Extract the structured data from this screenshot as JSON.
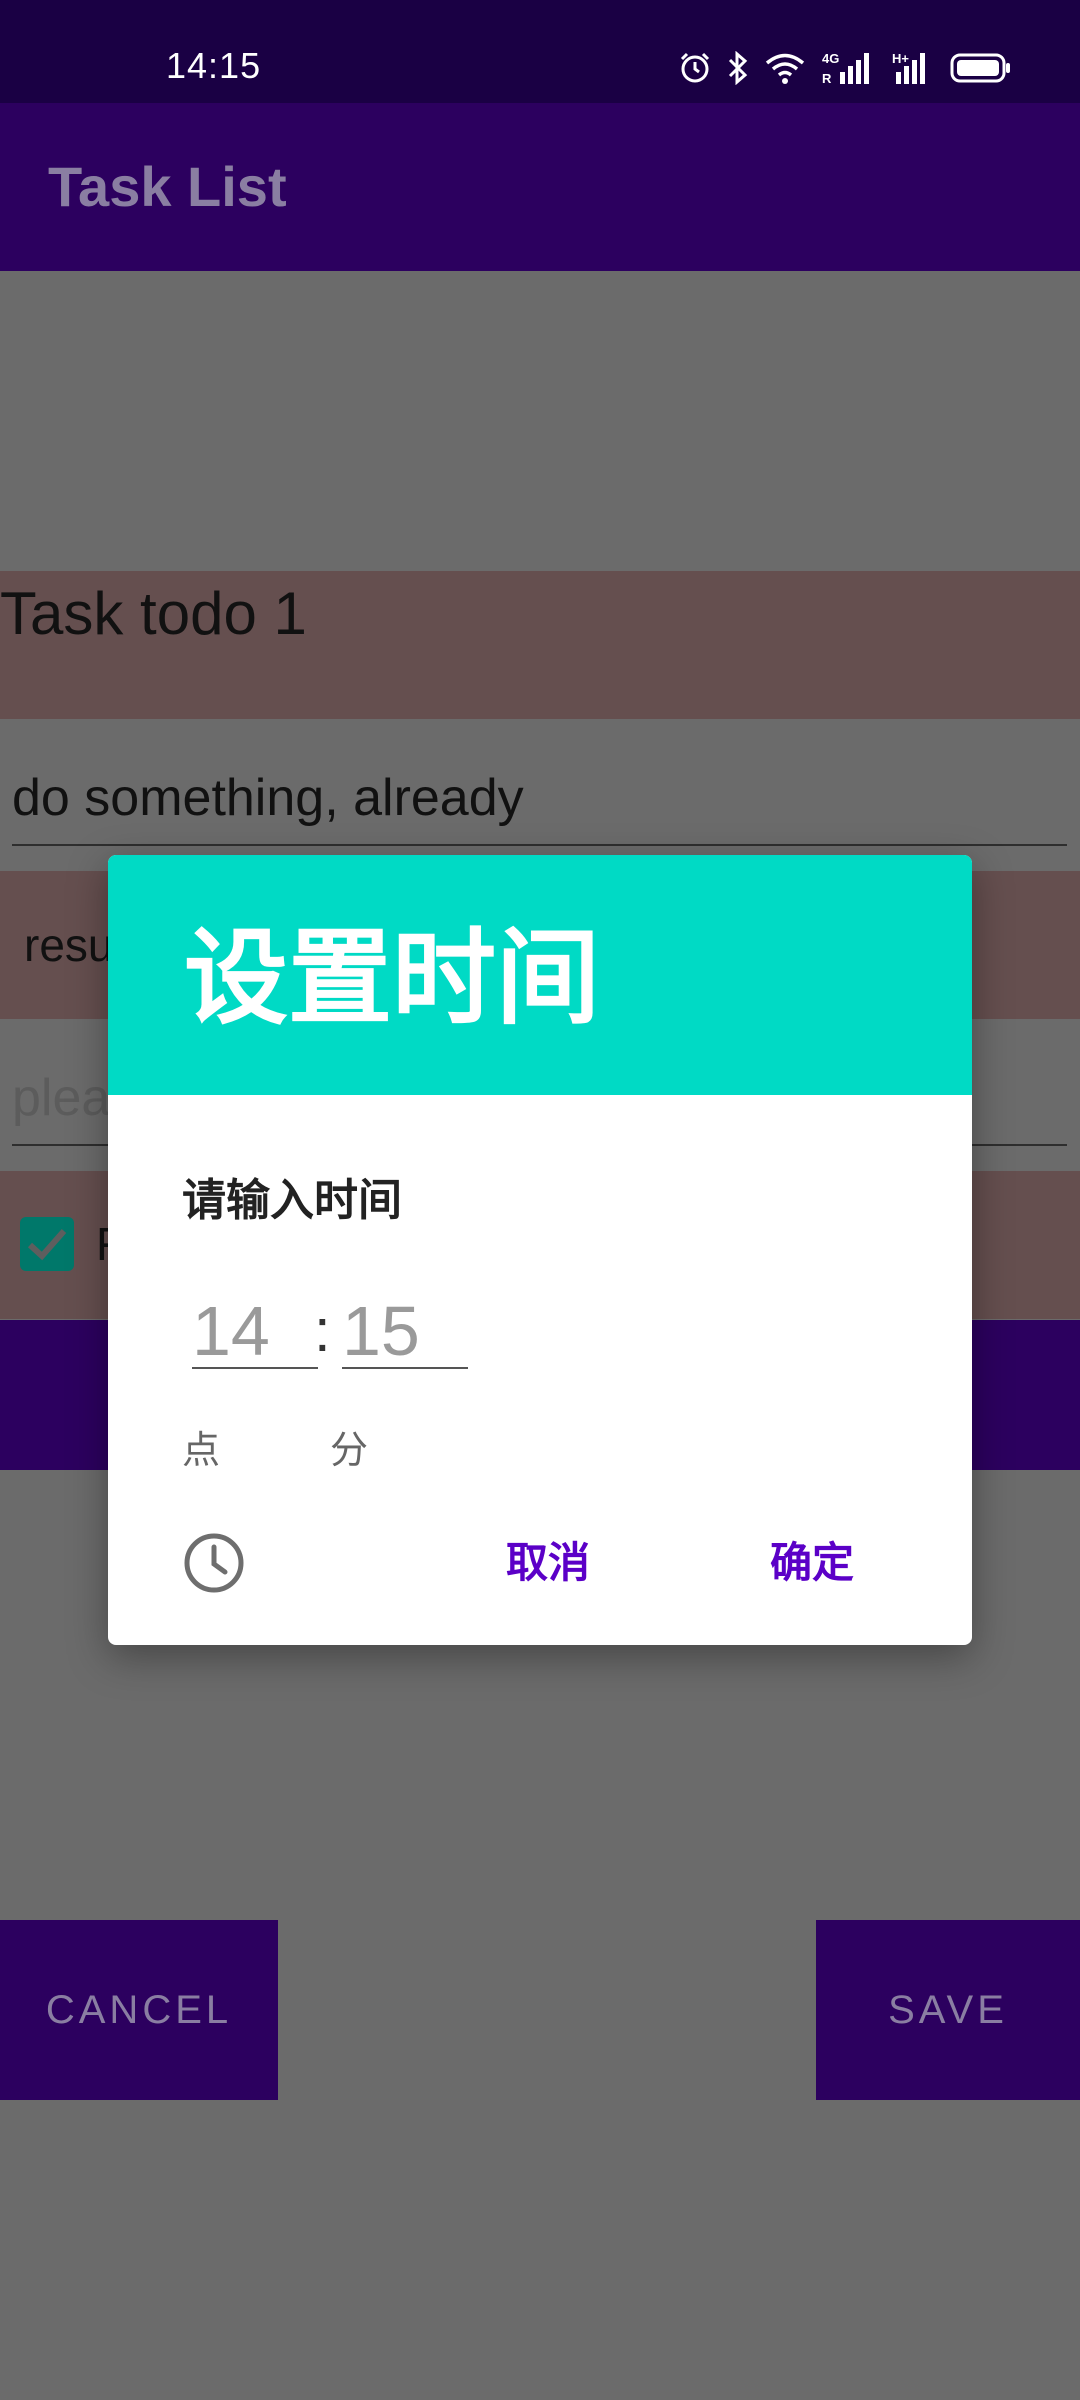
{
  "status_bar": {
    "time": "14:15",
    "icons": [
      "alarm-icon",
      "bluetooth-icon",
      "wifi-icon",
      "signal-4g-icon",
      "signal-h-plus-icon",
      "battery-icon"
    ],
    "network_labels": [
      "4G",
      "R",
      "H+"
    ]
  },
  "app_bar": {
    "title": "Task List"
  },
  "form": {
    "task_name": "Task todo 1",
    "description": "do something, already",
    "result_label": "resu",
    "extra_placeholder": "plea",
    "checkbox_label": "F",
    "checkbox_checked": true
  },
  "buttons": {
    "cancel": "CANCEL",
    "save": "SAVE"
  },
  "dialog": {
    "title": "设置时间",
    "prompt": "请输入时间",
    "hour": "14",
    "separator": ":",
    "minute": "15",
    "hour_unit": "点",
    "minute_unit": "分",
    "cancel": "取消",
    "confirm": "确定",
    "mode_icon": "clock-icon"
  },
  "colors": {
    "status_bar": "#1a0044",
    "app_bar": "#2c005f",
    "dialog_header": "#00dac5",
    "dialog_button": "#5b00c7",
    "scrim": "#6b6b6b"
  }
}
